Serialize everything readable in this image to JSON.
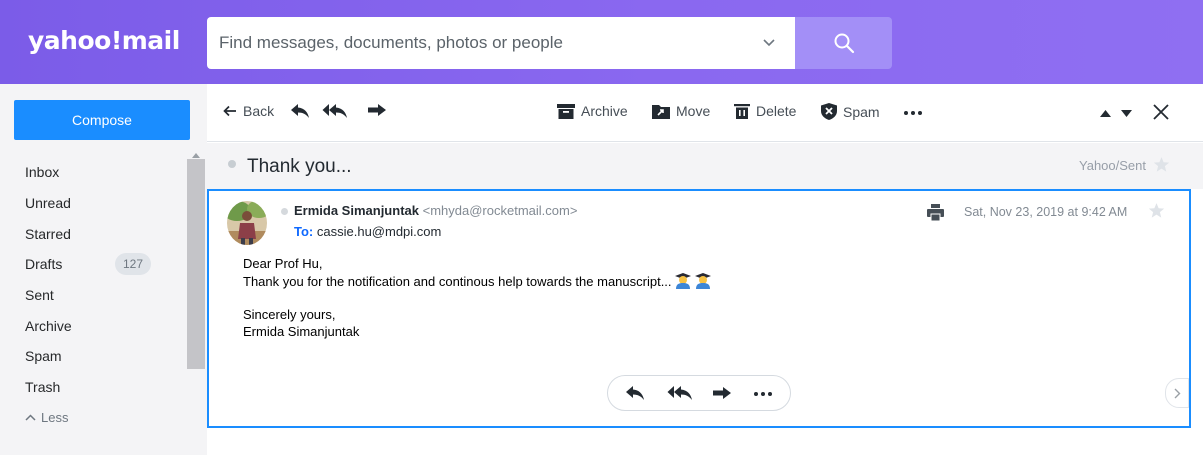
{
  "app": {
    "logo_text": "yahoo!mail"
  },
  "search": {
    "placeholder": "Find messages, documents, photos or people"
  },
  "sidebar": {
    "compose_label": "Compose",
    "items": [
      {
        "label": "Inbox"
      },
      {
        "label": "Unread"
      },
      {
        "label": "Starred"
      },
      {
        "label": "Drafts",
        "count": "127"
      },
      {
        "label": "Sent"
      },
      {
        "label": "Archive"
      },
      {
        "label": "Spam"
      },
      {
        "label": "Trash"
      }
    ],
    "less_label": "Less"
  },
  "toolbar": {
    "back_label": "Back",
    "archive_label": "Archive",
    "move_label": "Move",
    "delete_label": "Delete",
    "spam_label": "Spam"
  },
  "thread": {
    "subject": "Thank you...",
    "folder": "Yahoo/Sent"
  },
  "message": {
    "sender_name": "Ermida Simanjuntak",
    "sender_email": "<mhyda@rocketmail.com>",
    "to_label": "To:",
    "to_address": "cassie.hu@mdpi.com",
    "date": "Sat, Nov 23, 2019 at 9:42 AM",
    "body": [
      "Dear Prof Hu,",
      "Thank you for the notification and continous help towards the manuscript...",
      "",
      "Sincerely yours,",
      "Ermida Simanjuntak"
    ]
  },
  "colors": {
    "header_bg": "#7b5ce8",
    "search_button": "#a38ff7",
    "compose": "#1a8dff",
    "sidebar_bg": "#f4f4f6",
    "message_border": "#1a8dff"
  },
  "icons": {
    "search": "search-icon",
    "back": "arrow-left-icon",
    "reply": "reply-icon",
    "reply_all": "reply-all-icon",
    "forward": "forward-icon",
    "archive": "archive-icon",
    "move": "move-icon",
    "delete": "trash-icon",
    "spam": "shield-icon",
    "more": "more-dots-icon",
    "prev": "caret-up-icon",
    "next": "caret-down-icon",
    "close": "close-icon",
    "star": "star-icon",
    "print": "print-icon"
  }
}
